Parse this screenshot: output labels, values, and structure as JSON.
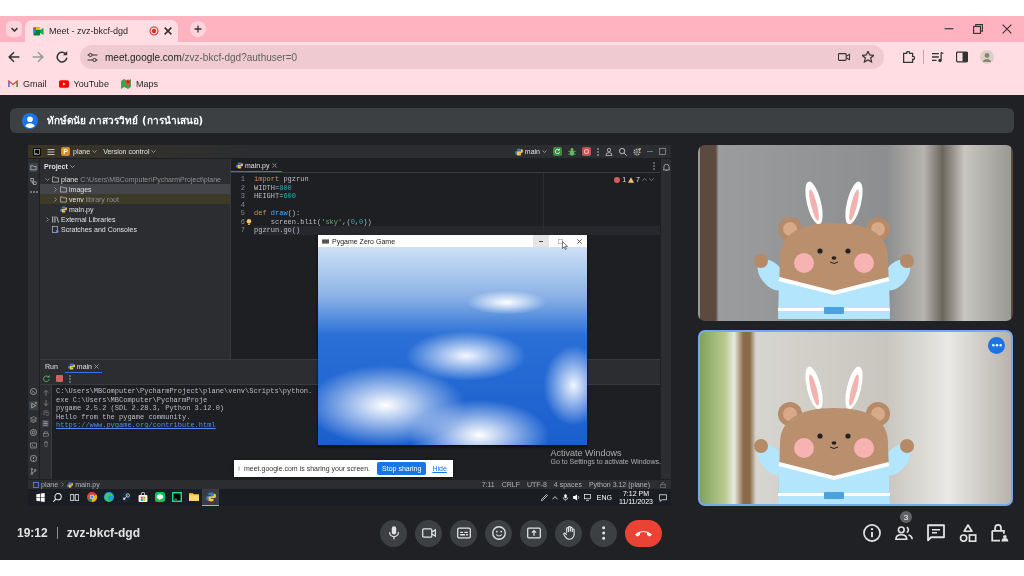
{
  "browser": {
    "tabs": [
      {
        "title": "Meet - zvz-bkcf-dgd",
        "recording": true,
        "selected": true
      }
    ],
    "address": {
      "host": "meet.google.com",
      "path": "/zvz-bkcf-dgd?authuser=0"
    },
    "bookmarks": [
      {
        "label": "Gmail",
        "kind": "mail"
      },
      {
        "label": "YouTube",
        "kind": "video"
      },
      {
        "label": "Maps",
        "kind": "map"
      }
    ]
  },
  "presenter_bar": {
    "title": "ทักษ์ดนัย ภาสวรวิทย์ (การนำเสนอ)"
  },
  "shared_screen": {
    "ide": {
      "project": {
        "initial": "P",
        "name": "plane"
      },
      "vcs": "Version control",
      "run_config": "main",
      "project_panel": {
        "title": "Project",
        "tree": [
          {
            "label": "plane",
            "hint": "C:\\Users\\MBComputer\\PycharmProject\\plane",
            "kind": "folder",
            "expanded": true,
            "selected": false,
            "excluded": false,
            "children": [
              {
                "label": "images",
                "kind": "folder",
                "expanded": false,
                "selected": true,
                "excluded": false
              },
              {
                "label": "venv",
                "hint": "library root",
                "kind": "folder",
                "expanded": false,
                "selected": false,
                "excluded": true
              },
              {
                "label": "main.py",
                "kind": "python",
                "selected": false,
                "excluded": false
              }
            ]
          },
          {
            "label": "External Libraries",
            "kind": "library",
            "expanded": false,
            "selected": false,
            "excluded": false
          },
          {
            "label": "Scratches and Consoles",
            "kind": "scratch",
            "selected": false,
            "excluded": false
          }
        ]
      },
      "editor_tabs": [
        {
          "label": "main.py",
          "selected": true
        }
      ],
      "inspections": {
        "errors": "1",
        "warnings": "7"
      },
      "code": [
        {
          "number": "1",
          "current": false,
          "bulb": false,
          "tokens": [
            {
              "text": "import",
              "kind": "keyword"
            },
            {
              "text": " pgzrun",
              "kind": "plain"
            }
          ]
        },
        {
          "number": "2",
          "current": false,
          "bulb": false,
          "tokens": [
            {
              "text": "WIDTH=",
              "kind": "plain"
            },
            {
              "text": "800",
              "kind": "number"
            }
          ]
        },
        {
          "number": "3",
          "current": false,
          "bulb": false,
          "tokens": [
            {
              "text": "HEIGHT=",
              "kind": "plain"
            },
            {
              "text": "600",
              "kind": "number"
            }
          ]
        },
        {
          "number": "4",
          "current": false,
          "bulb": false
        },
        {
          "number": "5",
          "current": false,
          "bulb": false,
          "tokens": [
            {
              "text": "def",
              "kind": "keyword"
            },
            {
              "text": " draw",
              "kind": "function"
            },
            {
              "text": "():",
              "kind": "plain"
            }
          ]
        },
        {
          "number": "6",
          "current": false,
          "bulb": true,
          "tokens": [
            {
              "text": "    screen.blit(",
              "kind": "plain"
            },
            {
              "text": "'sky'",
              "kind": "string"
            },
            {
              "text": ",(",
              "kind": "plain"
            },
            {
              "text": "0",
              "kind": "number"
            },
            {
              "text": ",",
              "kind": "plain"
            },
            {
              "text": "0",
              "kind": "number"
            },
            {
              "text": "))",
              "kind": "plain"
            }
          ]
        },
        {
          "number": "7",
          "current": true,
          "bulb": false,
          "tokens": [
            {
              "text": "pgzrun.go()",
              "kind": "plain"
            }
          ]
        }
      ],
      "run_panel": {
        "title": "Run",
        "tabs": [
          {
            "label": "main",
            "selected": true
          }
        ],
        "output": [
          {
            "text": "C:\\Users\\MBComputer\\PycharmProject\\plane\\venv\\Scripts\\python.exe C:\\Users\\MBComputer\\PycharmProje"
          },
          {
            "text": "pygame 2.5.2 (SDL 2.28.3, Python 3.12.0)"
          },
          {
            "text": "Hello from the pygame community. ",
            "link": "https://www.pygame.org/contribute.html"
          }
        ]
      },
      "status_bar": {
        "path": [
          "plane",
          "main.py"
        ],
        "items": [
          "7:11",
          "CRLF",
          "UTF-8",
          "4 spaces",
          "Python 3.12 (plane)"
        ]
      }
    },
    "game_window": {
      "title": "Pygame Zero Game"
    },
    "activation_notice": {
      "title": "Activate Windows",
      "text": "Go to Settings to activate Windows."
    },
    "sharing_bar": {
      "message": "meet.google.com is sharing your screen.",
      "stop": "Stop sharing",
      "hide": "Hide"
    },
    "taskbar": {
      "apps": [
        {
          "kind": "chrome",
          "selected": false
        },
        {
          "kind": "edge",
          "selected": false
        },
        {
          "kind": "steam",
          "selected": false
        },
        {
          "kind": "store",
          "selected": false
        },
        {
          "kind": "line",
          "selected": false
        },
        {
          "kind": "pycharm",
          "selected": false
        },
        {
          "kind": "explorer",
          "selected": false
        },
        {
          "kind": "python",
          "selected": true
        }
      ],
      "language": "ENG",
      "time": "7:12 PM",
      "date": "11/11/2023"
    }
  },
  "tiles": [
    {
      "selected": false
    },
    {
      "selected": true
    }
  ],
  "meeting": {
    "time": "19:12",
    "code": "zvz-bkcf-dgd"
  },
  "controls": [
    {
      "kind": "mic"
    },
    {
      "kind": "camera"
    },
    {
      "kind": "captions"
    },
    {
      "kind": "emoji"
    },
    {
      "kind": "present"
    },
    {
      "kind": "hand"
    },
    {
      "kind": "more"
    },
    {
      "kind": "leave"
    }
  ],
  "side_controls": [
    {
      "kind": "info"
    },
    {
      "kind": "people",
      "badge": "3"
    },
    {
      "kind": "chat"
    },
    {
      "kind": "activities"
    },
    {
      "kind": "host"
    }
  ]
}
